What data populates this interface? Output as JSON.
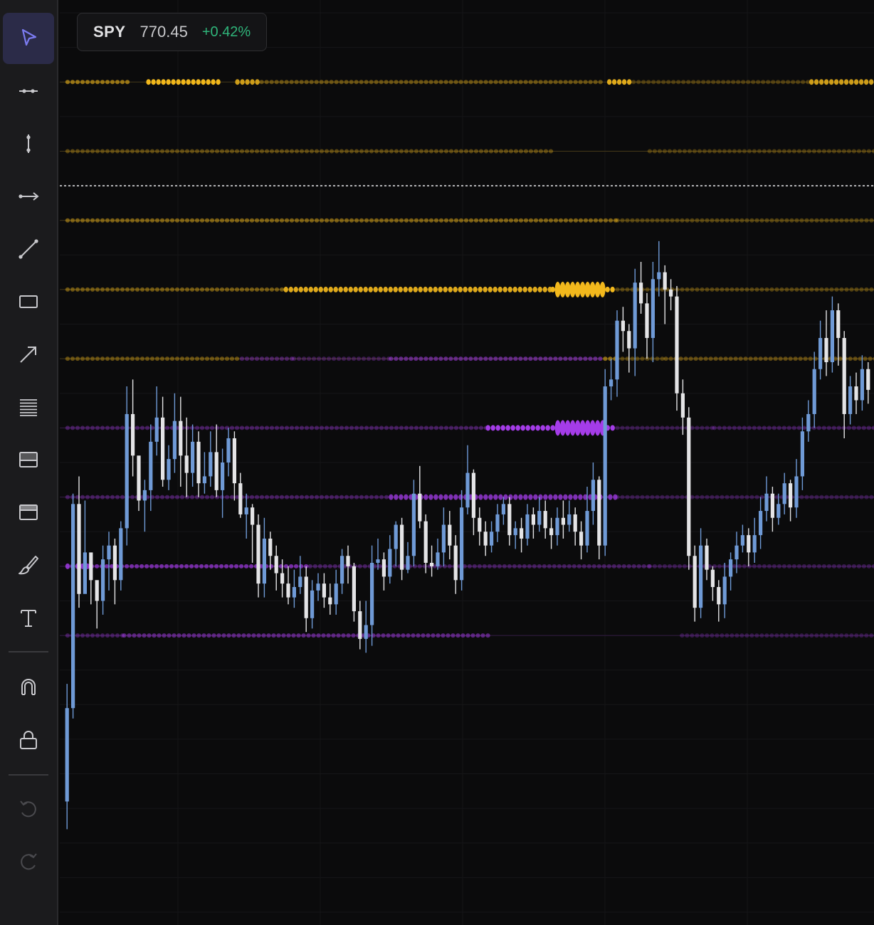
{
  "ticker": {
    "symbol": "SPY",
    "price": "770.45",
    "change": "+0.42%"
  },
  "colors": {
    "background": "#0b0b0c",
    "toolbar": "#1b1b1d",
    "bull": "#6f9ad6",
    "bear": "#e4e4e6",
    "buy_flow": "#f2b81c",
    "sell_flow": "#a43ce8",
    "active_tool": "#5b5bd6",
    "positive": "#2fb57a"
  },
  "toolbar": {
    "tools": [
      {
        "name": "cursor-icon",
        "active": true
      },
      {
        "name": "horizontal-line-icon"
      },
      {
        "name": "vertical-line-icon"
      },
      {
        "name": "horizontal-ray-icon"
      },
      {
        "name": "trend-line-icon"
      },
      {
        "name": "rectangle-icon"
      },
      {
        "name": "arrow-icon"
      },
      {
        "name": "fib-retracement-icon"
      },
      {
        "name": "long-position-icon"
      },
      {
        "name": "short-position-icon"
      },
      {
        "name": "brush-icon"
      },
      {
        "name": "text-icon"
      },
      {
        "name": "magnet-icon"
      },
      {
        "name": "lock-icon"
      },
      {
        "name": "undo-icon",
        "disabled": true
      },
      {
        "name": "redo-icon",
        "disabled": true
      }
    ]
  },
  "chart_data": {
    "type": "candlestick",
    "symbol": "SPY",
    "last_price": 770.45,
    "ylim": [
      752,
      778
    ],
    "current_price_line": 773,
    "candles": [
      [
        755.2,
        757.9,
        758.6,
        754.4
      ],
      [
        757.9,
        763.8,
        764.1,
        757.6
      ],
      [
        763.8,
        761.2,
        764.6,
        760.8
      ],
      [
        761.2,
        762.4,
        763.9,
        761.6
      ],
      [
        762.4,
        761.6,
        762.0,
        760.9
      ],
      [
        761.6,
        761.0,
        761.5,
        760.2
      ],
      [
        761.0,
        762.2,
        762.6,
        760.6
      ],
      [
        762.2,
        762.6,
        763.0,
        761.3
      ],
      [
        762.6,
        761.6,
        762.8,
        760.9
      ],
      [
        761.6,
        763.1,
        763.3,
        761.3
      ],
      [
        763.1,
        766.4,
        767.2,
        762.6
      ],
      [
        766.4,
        765.2,
        767.4,
        764.6
      ],
      [
        765.2,
        763.9,
        765.1,
        763.6
      ],
      [
        763.9,
        764.2,
        764.5,
        763.0
      ],
      [
        764.2,
        765.6,
        766.1,
        763.6
      ],
      [
        765.6,
        766.3,
        767.2,
        765.2
      ],
      [
        766.3,
        764.5,
        766.9,
        764.3
      ],
      [
        764.5,
        765.1,
        765.5,
        764.2
      ],
      [
        765.1,
        766.2,
        767.0,
        764.7
      ],
      [
        766.2,
        765.2,
        766.9,
        764.3
      ],
      [
        765.2,
        764.7,
        766.3,
        764.0
      ],
      [
        764.7,
        765.6,
        766.1,
        764.3
      ],
      [
        765.6,
        764.4,
        765.9,
        764.0
      ],
      [
        764.4,
        764.6,
        765.3,
        764.1
      ],
      [
        764.6,
        765.3,
        765.9,
        764.3
      ],
      [
        765.3,
        764.2,
        766.1,
        764.0
      ],
      [
        764.2,
        765.0,
        765.4,
        763.4
      ],
      [
        765.0,
        765.7,
        766.0,
        764.6
      ],
      [
        765.7,
        764.4,
        765.9,
        763.9
      ],
      [
        764.4,
        763.5,
        764.7,
        763.4
      ],
      [
        763.5,
        763.7,
        764.1,
        762.8
      ],
      [
        763.7,
        763.2,
        763.8,
        762.1
      ],
      [
        763.2,
        761.5,
        763.5,
        761.1
      ],
      [
        761.5,
        762.8,
        763.4,
        761.1
      ],
      [
        762.8,
        762.3,
        763.0,
        761.9
      ],
      [
        762.3,
        761.8,
        762.6,
        761.3
      ],
      [
        761.8,
        761.5,
        762.2,
        761.1
      ],
      [
        761.5,
        761.1,
        762.0,
        760.9
      ],
      [
        761.1,
        761.4,
        761.9,
        760.8
      ],
      [
        761.4,
        761.7,
        762.3,
        761.2
      ],
      [
        761.7,
        760.5,
        762.0,
        760.1
      ],
      [
        760.5,
        761.3,
        761.6,
        760.2
      ],
      [
        761.3,
        761.5,
        761.8,
        761.0
      ],
      [
        761.5,
        761.1,
        761.8,
        760.8
      ],
      [
        761.1,
        760.9,
        761.5,
        760.6
      ],
      [
        760.9,
        761.5,
        761.9,
        760.6
      ],
      [
        761.5,
        762.3,
        762.5,
        761.2
      ],
      [
        762.3,
        762.0,
        762.6,
        761.5
      ],
      [
        762.0,
        760.7,
        762.1,
        760.4
      ],
      [
        760.7,
        759.9,
        761.0,
        759.6
      ],
      [
        759.9,
        760.3,
        761.0,
        759.5
      ],
      [
        760.3,
        762.1,
        762.6,
        759.7
      ],
      [
        762.1,
        762.2,
        762.8,
        761.9
      ],
      [
        762.2,
        761.7,
        762.4,
        761.3
      ],
      [
        761.7,
        762.5,
        762.9,
        761.5
      ],
      [
        762.5,
        763.2,
        763.3,
        762.0
      ],
      [
        763.2,
        761.9,
        763.4,
        761.6
      ],
      [
        761.9,
        762.3,
        762.7,
        761.8
      ],
      [
        762.3,
        764.1,
        764.5,
        762.0
      ],
      [
        764.1,
        763.3,
        764.9,
        763.1
      ],
      [
        763.3,
        762.1,
        763.5,
        761.8
      ],
      [
        762.1,
        762.0,
        762.6,
        761.7
      ],
      [
        762.0,
        762.4,
        762.8,
        761.9
      ],
      [
        762.4,
        763.2,
        763.7,
        762.0
      ],
      [
        763.2,
        762.6,
        763.6,
        762.2
      ],
      [
        762.6,
        761.6,
        762.9,
        761.2
      ],
      [
        761.6,
        763.7,
        764.2,
        761.3
      ],
      [
        763.7,
        764.7,
        765.5,
        763.5
      ],
      [
        764.7,
        763.4,
        764.8,
        762.9
      ],
      [
        763.4,
        763.0,
        763.7,
        762.6
      ],
      [
        763.0,
        762.6,
        763.3,
        762.3
      ],
      [
        762.6,
        763.0,
        763.3,
        762.4
      ],
      [
        763.0,
        763.5,
        763.8,
        762.7
      ],
      [
        763.5,
        763.8,
        764.0,
        763.2
      ],
      [
        763.8,
        762.9,
        764.0,
        762.6
      ],
      [
        762.9,
        763.1,
        763.3,
        762.5
      ],
      [
        763.1,
        762.8,
        763.4,
        762.4
      ],
      [
        762.8,
        763.5,
        763.8,
        762.6
      ],
      [
        763.5,
        763.2,
        763.7,
        762.8
      ],
      [
        763.2,
        763.6,
        764.0,
        763.0
      ],
      [
        763.6,
        763.1,
        763.9,
        762.8
      ],
      [
        763.1,
        762.9,
        763.4,
        762.5
      ],
      [
        762.9,
        763.4,
        763.7,
        762.6
      ],
      [
        763.4,
        763.2,
        763.9,
        762.8
      ],
      [
        763.2,
        763.5,
        763.9,
        763.0
      ],
      [
        763.5,
        763.0,
        763.7,
        762.6
      ],
      [
        763.0,
        762.6,
        763.3,
        762.2
      ],
      [
        762.6,
        763.6,
        764.3,
        762.4
      ],
      [
        763.6,
        764.5,
        765.0,
        763.2
      ],
      [
        764.5,
        762.6,
        764.6,
        762.2
      ],
      [
        762.6,
        767.2,
        767.7,
        762.3
      ],
      [
        767.2,
        767.4,
        768.0,
        766.8
      ],
      [
        767.4,
        769.1,
        769.4,
        766.9
      ],
      [
        769.1,
        768.8,
        769.5,
        768.2
      ],
      [
        768.8,
        768.3,
        769.0,
        767.6
      ],
      [
        768.3,
        770.2,
        770.6,
        767.5
      ],
      [
        770.2,
        769.6,
        770.8,
        769.3
      ],
      [
        769.6,
        768.6,
        769.9,
        768.0
      ],
      [
        768.6,
        770.3,
        770.8,
        767.9
      ],
      [
        770.3,
        770.5,
        771.4,
        769.8
      ],
      [
        770.5,
        770.0,
        770.7,
        769.0
      ],
      [
        770.0,
        769.8,
        770.3,
        769.4
      ],
      [
        769.8,
        767.0,
        770.1,
        766.5
      ],
      [
        767.0,
        766.3,
        767.4,
        765.8
      ],
      [
        766.3,
        762.3,
        766.6,
        761.9
      ],
      [
        762.3,
        760.8,
        762.6,
        760.4
      ],
      [
        760.8,
        762.6,
        763.1,
        760.5
      ],
      [
        762.6,
        761.9,
        762.8,
        761.6
      ],
      [
        761.9,
        761.4,
        762.0,
        761.0
      ],
      [
        761.4,
        760.9,
        761.6,
        760.4
      ],
      [
        760.9,
        761.7,
        762.1,
        760.5
      ],
      [
        761.7,
        762.2,
        762.4,
        761.3
      ],
      [
        762.2,
        762.6,
        763.0,
        761.8
      ],
      [
        762.6,
        762.9,
        763.2,
        762.4
      ],
      [
        762.9,
        762.4,
        763.1,
        762.0
      ],
      [
        762.4,
        762.9,
        763.4,
        762.1
      ],
      [
        762.9,
        763.6,
        764.0,
        762.5
      ],
      [
        763.6,
        764.1,
        764.6,
        763.3
      ],
      [
        764.1,
        763.4,
        764.3,
        763.0
      ],
      [
        763.4,
        763.8,
        764.1,
        763.2
      ],
      [
        763.8,
        764.4,
        764.7,
        763.5
      ],
      [
        764.4,
        763.7,
        764.5,
        763.3
      ],
      [
        763.7,
        764.6,
        765.1,
        763.4
      ],
      [
        764.6,
        765.9,
        766.3,
        764.2
      ],
      [
        765.9,
        766.4,
        766.8,
        765.6
      ],
      [
        766.4,
        767.7,
        768.2,
        766.0
      ],
      [
        767.7,
        768.6,
        769.1,
        767.4
      ],
      [
        768.6,
        767.9,
        769.4,
        767.5
      ],
      [
        767.9,
        769.4,
        769.8,
        767.6
      ],
      [
        769.4,
        768.6,
        769.6,
        767.8
      ],
      [
        768.6,
        766.4,
        768.8,
        765.7
      ],
      [
        766.4,
        767.2,
        767.5,
        766.1
      ],
      [
        767.2,
        766.8,
        767.6,
        766.4
      ],
      [
        766.8,
        767.7,
        768.1,
        766.5
      ],
      [
        767.7,
        767.1,
        767.9,
        766.7
      ]
    ],
    "order_flow_levels": [
      {
        "price": 776.0,
        "side": "buy",
        "intensity": 0.75,
        "segments": [
          [
            0.0,
            0.08,
            0.5
          ],
          [
            0.1,
            0.19,
            1.0
          ],
          [
            0.21,
            0.24,
            0.8
          ],
          [
            0.24,
            0.66,
            0.25
          ],
          [
            0.67,
            0.7,
            0.9
          ],
          [
            0.7,
            0.92,
            0.1
          ],
          [
            0.92,
            1.0,
            0.8
          ]
        ]
      },
      {
        "price": 774.0,
        "side": "buy",
        "intensity": 0.25,
        "segments": [
          [
            0.0,
            0.6,
            0.18
          ],
          [
            0.72,
            1.0,
            0.1
          ]
        ]
      },
      {
        "price": 772.0,
        "side": "buy",
        "intensity": 0.55,
        "segments": [
          [
            0.0,
            0.68,
            0.35
          ],
          [
            0.68,
            1.0,
            0.15
          ]
        ]
      },
      {
        "price": 770.0,
        "side": "buy",
        "intensity": 1.0,
        "segments": [
          [
            0.0,
            0.27,
            0.3
          ],
          [
            0.27,
            0.6,
            0.9
          ],
          [
            0.6,
            0.68,
            1.0
          ],
          [
            0.68,
            1.0,
            0.15
          ]
        ]
      },
      {
        "price": 768.0,
        "side": "mixed",
        "intensity": 0.45,
        "segments": [
          [
            0.0,
            0.28,
            0.25
          ],
          [
            0.28,
            0.4,
            0.15
          ],
          [
            0.4,
            0.68,
            0.45
          ],
          [
            0.68,
            0.74,
            0.15
          ],
          [
            0.74,
            1.0,
            0.2
          ]
        ]
      },
      {
        "price": 766.0,
        "side": "sell",
        "intensity": 1.0,
        "segments": [
          [
            0.0,
            0.52,
            0.2
          ],
          [
            0.52,
            0.68,
            1.0
          ],
          [
            0.68,
            0.8,
            0.1
          ],
          [
            0.8,
            1.0,
            0.15
          ]
        ]
      },
      {
        "price": 764.0,
        "side": "sell",
        "intensity": 0.85,
        "segments": [
          [
            0.0,
            0.4,
            0.2
          ],
          [
            0.4,
            0.68,
            0.7
          ],
          [
            0.68,
            1.0,
            0.1
          ]
        ]
      },
      {
        "price": 762.0,
        "side": "sell",
        "intensity": 0.75,
        "segments": [
          [
            0.0,
            0.03,
            0.8
          ],
          [
            0.03,
            0.3,
            0.6
          ],
          [
            0.3,
            0.72,
            0.2
          ],
          [
            0.72,
            1.0,
            0.12
          ]
        ]
      },
      {
        "price": 760.0,
        "side": "sell",
        "intensity": 0.65,
        "segments": [
          [
            0.0,
            0.07,
            0.2
          ],
          [
            0.07,
            0.52,
            0.4
          ],
          [
            0.76,
            1.0,
            0.1
          ]
        ]
      }
    ]
  }
}
